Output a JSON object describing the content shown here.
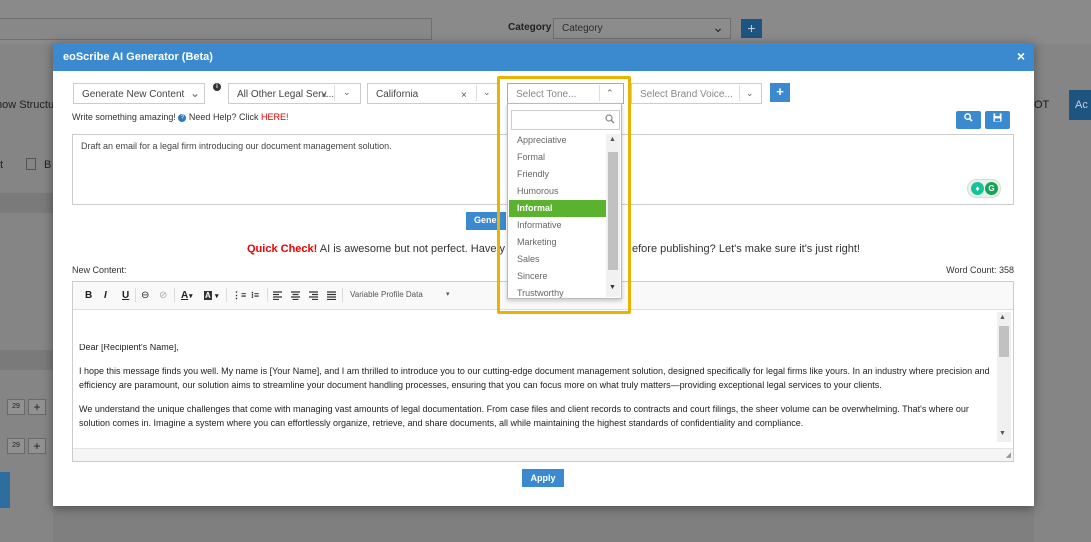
{
  "background": {
    "category_label": "Category",
    "category_value": "Category",
    "plus": "+",
    "structure_text": "how Structu",
    "right_text": "OT",
    "right_button": "Ac",
    "left_t": "t",
    "left_b": "B",
    "small_btn": "29",
    "small_plus": "+"
  },
  "modal": {
    "title": "eoScribe AI Generator (Beta)",
    "close": "×",
    "mode_select": "Generate New Content",
    "info": "i",
    "industry_select": "All Other Legal Serv...",
    "state_select": "California",
    "tone_placeholder": "Select Tone...",
    "brand_placeholder": "Select Brand Voice...",
    "plus": "+",
    "write_prefix": "Write something amazing!",
    "help_text": "Need Help? Click",
    "help_link": "HERE!",
    "prompt": "Draft an email for a legal firm introducing our document management solution.",
    "generate": "Gene",
    "quick_check_label": "Quick Check!",
    "quick_check_text": "AI is awesome but not perfect. Have y",
    "quick_check_tail": "efore publishing? Let's make sure it's just right!",
    "new_content_label": "New Content:",
    "word_count": "Word Count: 358",
    "variable_profile": "Variable Profile Data",
    "apply": "Apply",
    "content": {
      "p1": "Dear [Recipient's Name],",
      "p2": "I hope this message finds you well. My name is [Your Name], and I am thrilled to introduce you to our cutting-edge document management solution, designed specifically for legal firms like yours. In an industry where precision and efficiency are paramount, our solution aims to streamline your document handling processes, ensuring that you can focus more on what truly matters—providing exceptional legal services to your clients.",
      "p3": "We understand the unique challenges that come with managing vast amounts of legal documentation. From case files and client records to contracts and court filings, the sheer volume can be overwhelming. That's where our solution comes in. Imagine a system where you can effortlessly organize, retrieve, and share documents, all while maintaining the highest standards of confidentiality and compliance."
    }
  },
  "toolbar": {
    "bold": "B",
    "italic": "I",
    "underline": "U",
    "link": "⊖",
    "unlink": "⊘",
    "font_color": "A",
    "bg_color": "A",
    "ordered_list": "⋮≡",
    "bullet_list": "⁝≡",
    "caret": "▾"
  },
  "tone_dropdown": {
    "options": [
      "Appreciative",
      "Formal",
      "Friendly",
      "Humorous",
      "Informal",
      "Informative",
      "Marketing",
      "Sales",
      "Sincere",
      "Trustworthy"
    ],
    "selected": "Informal",
    "highlight_color": "#e8b400",
    "selected_color": "#5bb22f"
  },
  "colors": {
    "header": "#3b8ad0",
    "warning": "#e00000"
  }
}
